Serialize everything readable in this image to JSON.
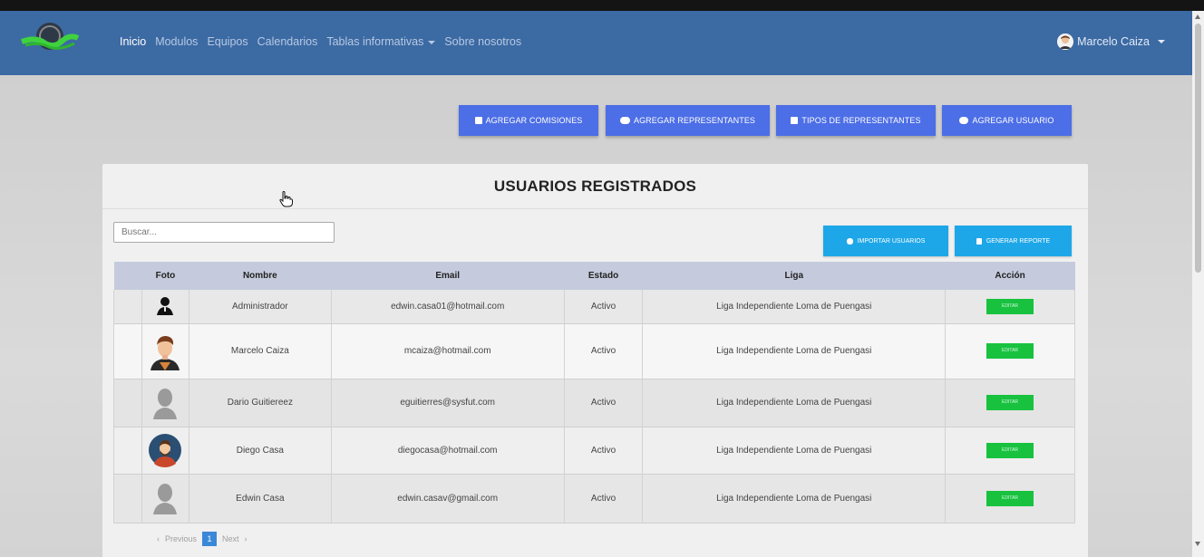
{
  "nav": {
    "links": [
      "Inicio",
      "Modulos",
      "Equipos",
      "Calendarios",
      "Tablas informativas",
      "Sobre nosotros"
    ],
    "user_name": "Marcelo Caiza"
  },
  "actions": {
    "agregar_comisiones": "AGREGAR COMISIONES",
    "agregar_representantes": "AGREGAR REPRESENTANTES",
    "tipos_representantes": "TIPOS DE REPRESENTANTES",
    "agregar_usuario": "AGREGAR USUARIO"
  },
  "card": {
    "title": "USUARIOS REGISTRADOS",
    "search_placeholder": "Buscar...",
    "importar": "IMPORTAR USUARIOS",
    "reporte": "GENERAR REPORTE"
  },
  "table": {
    "headers": [
      "Foto",
      "Nombre",
      "Email",
      "Estado",
      "Liga",
      "Acción"
    ],
    "edit_label": "EDITAR",
    "rows": [
      {
        "nombre": "Administrador",
        "email": "edwin.casa01@hotmail.com",
        "estado": "Activo",
        "liga": "Liga Independiente Loma de Puengasi"
      },
      {
        "nombre": "Marcelo Caiza",
        "email": "mcaiza@hotmail.com",
        "estado": "Activo",
        "liga": "Liga Independiente Loma de Puengasi"
      },
      {
        "nombre": "Dario Guitiereez",
        "email": "eguitierres@sysfut.com",
        "estado": "Activo",
        "liga": "Liga Independiente Loma de Puengasi"
      },
      {
        "nombre": "Diego Casa",
        "email": "diegocasa@hotmail.com",
        "estado": "Activo",
        "liga": "Liga Independiente Loma de Puengasi"
      },
      {
        "nombre": "Edwin Casa",
        "email": "edwin.casav@gmail.com",
        "estado": "Activo",
        "liga": "Liga Independiente Loma de Puengasi"
      }
    ]
  },
  "pagination": {
    "previous": "Previous",
    "page": "1",
    "next": "Next"
  }
}
